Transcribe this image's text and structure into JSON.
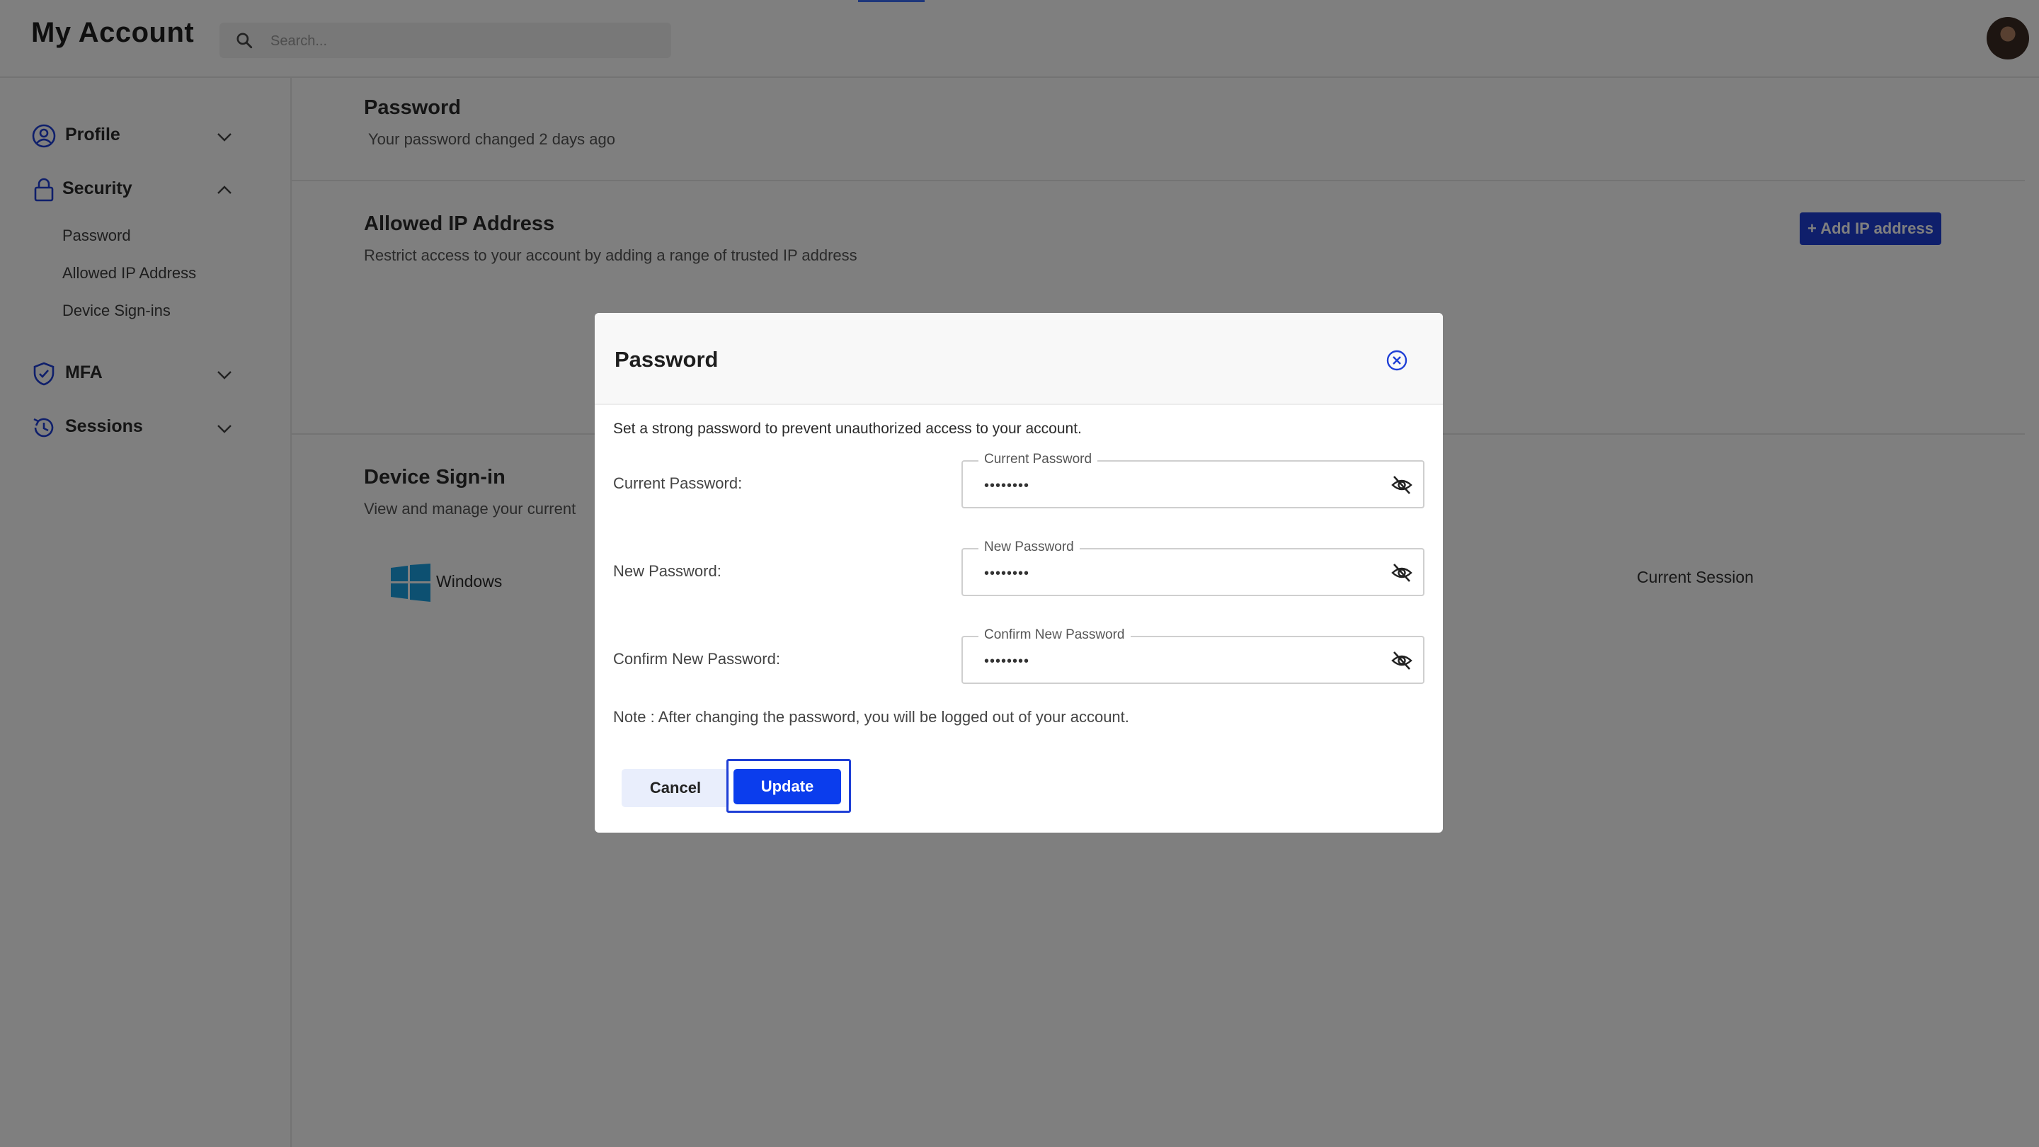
{
  "header": {
    "title": "My Account",
    "search_placeholder": "Search..."
  },
  "sidebar": {
    "groups": [
      {
        "label": "Profile",
        "icon": "user-circle-icon",
        "expanded": false
      },
      {
        "label": "Security",
        "icon": "lock-icon",
        "expanded": true,
        "items": [
          "Password",
          "Allowed IP Address",
          "Device Sign-ins"
        ]
      },
      {
        "label": "MFA",
        "icon": "shield-check-icon",
        "expanded": false
      },
      {
        "label": "Sessions",
        "icon": "history-icon",
        "expanded": false
      }
    ]
  },
  "main": {
    "password": {
      "title": "Password",
      "subtitle": "Your password changed 2 days ago"
    },
    "allowed_ip": {
      "title": "Allowed IP Address",
      "subtitle": "Restrict access to your account by adding a range of trusted IP address",
      "add_button": "+ Add IP address"
    },
    "device_signin": {
      "title": "Device Sign-in",
      "subtitle": "View and manage your current",
      "device_name": "Windows",
      "status": "Current Session"
    }
  },
  "modal": {
    "title": "Password",
    "description": "Set a strong password to prevent unauthorized access to your account.",
    "fields": [
      {
        "label": "Current Password:",
        "legend": "Current Password",
        "value": "••••••••"
      },
      {
        "label": "New Password:",
        "legend": "New Password",
        "value": "••••••••"
      },
      {
        "label": "Confirm New Password:",
        "legend": "Confirm New Password",
        "value": "••••••••"
      }
    ],
    "note": "Note : After changing the password, you will be logged out of your account.",
    "cancel_label": "Cancel",
    "update_label": "Update"
  },
  "colors": {
    "accent": "#1f3fd6",
    "primary_button": "#0b3ded",
    "cancel_bg": "#e9eefc",
    "windows_logo": "#1ba1e2"
  }
}
